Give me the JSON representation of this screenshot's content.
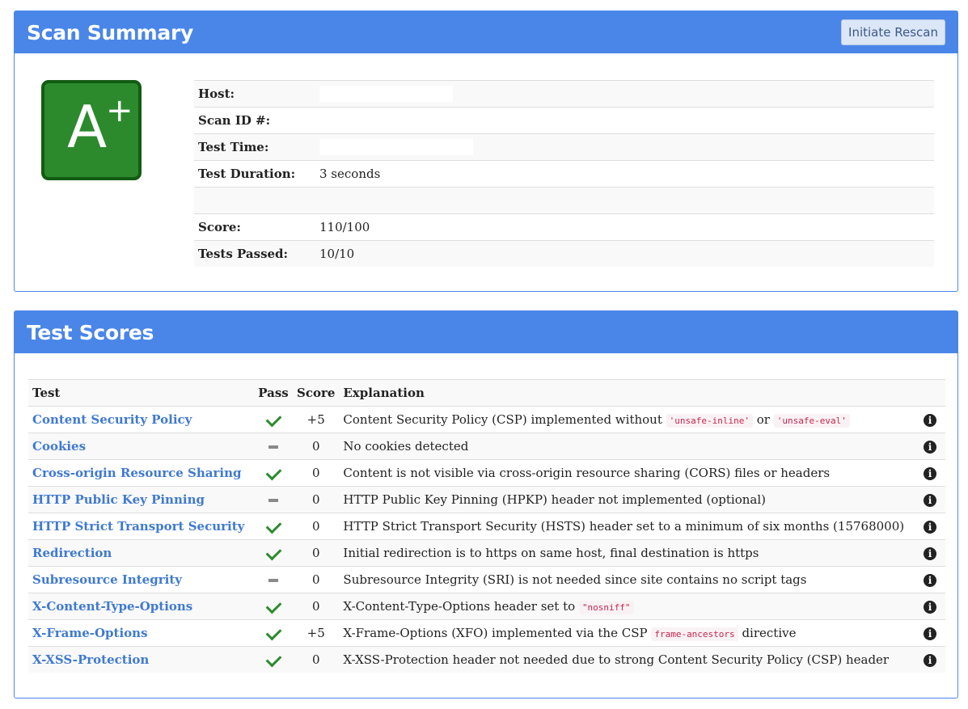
{
  "summary": {
    "title": "Scan Summary",
    "rescan_label": "Initiate Rescan",
    "grade": {
      "letter": "A",
      "modifier": "+",
      "color": "#2c8a2c"
    },
    "rows": {
      "host_label": "Host:",
      "scan_id_label": "Scan ID #:",
      "test_time_label": "Test Time:",
      "duration_label": "Test Duration:",
      "duration_value": "3 seconds",
      "score_label": "Score:",
      "score_value": "110/100",
      "passed_label": "Tests Passed:",
      "passed_value": "10/10"
    }
  },
  "scores": {
    "title": "Test Scores",
    "headers": {
      "test": "Test",
      "pass": "Pass",
      "score": "Score",
      "explanation": "Explanation"
    },
    "rows": [
      {
        "test": "Content Security Policy",
        "pass": "check",
        "score": "+5",
        "explanation": [
          "Content Security Policy (CSP) implemented without ",
          {
            "code": "'unsafe-inline'"
          },
          " or ",
          {
            "code": "'unsafe-eval'"
          }
        ]
      },
      {
        "test": "Cookies",
        "pass": "dash",
        "score": "0",
        "explanation": [
          "No cookies detected"
        ]
      },
      {
        "test": "Cross-origin Resource Sharing",
        "pass": "check",
        "score": "0",
        "explanation": [
          "Content is not visible via cross-origin resource sharing (CORS) files or headers"
        ]
      },
      {
        "test": "HTTP Public Key Pinning",
        "pass": "dash",
        "score": "0",
        "explanation": [
          "HTTP Public Key Pinning (HPKP) header not implemented (optional)"
        ]
      },
      {
        "test": "HTTP Strict Transport Security",
        "pass": "check",
        "score": "0",
        "explanation": [
          "HTTP Strict Transport Security (HSTS) header set to a minimum of six months (15768000)"
        ]
      },
      {
        "test": "Redirection",
        "pass": "check",
        "score": "0",
        "explanation": [
          "Initial redirection is to https on same host, final destination is https"
        ]
      },
      {
        "test": "Subresource Integrity",
        "pass": "dash",
        "score": "0",
        "explanation": [
          "Subresource Integrity (SRI) is not needed since site contains no script tags"
        ]
      },
      {
        "test": "X-Content-Type-Options",
        "pass": "check",
        "score": "0",
        "explanation": [
          "X-Content-Type-Options header set to ",
          {
            "code": "\"nosniff\""
          }
        ]
      },
      {
        "test": "X-Frame-Options",
        "pass": "check",
        "score": "+5",
        "explanation": [
          "X-Frame-Options (XFO) implemented via the CSP ",
          {
            "code": "frame-ancestors"
          },
          " directive"
        ]
      },
      {
        "test": "X-XSS-Protection",
        "pass": "check",
        "score": "0",
        "explanation": [
          "X-XSS-Protection header not needed due to strong Content Security Policy (CSP) header"
        ]
      }
    ],
    "info_glyph": "i"
  },
  "colors": {
    "header_blue": "#4a86e8",
    "link_blue": "#3f7ad0",
    "pass_green": "#2e8b2e",
    "code_red": "#c7254e"
  }
}
